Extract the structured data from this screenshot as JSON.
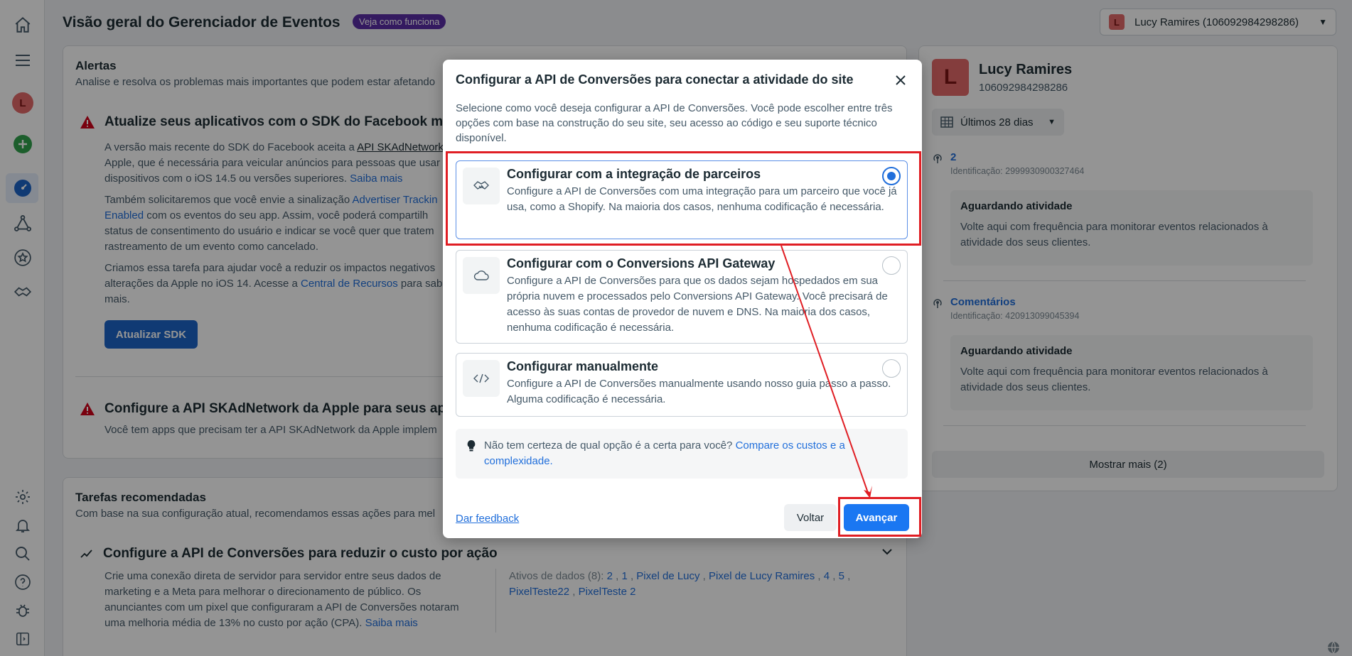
{
  "nav": {
    "avatar_letter": "L"
  },
  "header": {
    "title": "Visão geral do Gerenciador de Eventos",
    "how_badge": "Veja como funciona",
    "account_letter": "L",
    "account_label": "Lucy Ramires (106092984298286)"
  },
  "alerts": {
    "title": "Alertas",
    "subtitle": "Analise e resolva os problemas mais importantes que podem estar afetando",
    "item1": {
      "title": "Atualize seus aplicativos com o SDK do Facebook mais recen",
      "p1_a": "A versão mais recente do SDK do Facebook aceita a ",
      "p1_link": "API SKAdNetwork",
      "p1_b": "Apple, que é necessária para veicular anúncios para pessoas que usar",
      "p1_c": "dispositivos com o iOS 14.5 ou versões superiores. ",
      "p1_more": "Saiba mais",
      "p2_a": "Também solicitaremos que você envie a sinalização ",
      "p2_link1": "Advertiser Trackin",
      "p2_link2": "Enabled",
      "p2_b": " com os eventos do seu app. Assim, você poderá compartilh",
      "p2_c": "status de consentimento do usuário e indicar se você quer que tratem",
      "p2_d": "rastreamento de um evento como cancelado.",
      "p3_a": "Criamos essa tarefa para ajudar você a reduzir os impactos negativos",
      "p3_b": "alterações da Apple no iOS 14. Acesse a ",
      "p3_link": "Central de Recursos",
      "p3_c": " para sab",
      "p3_d": "mais.",
      "button": "Atualizar SDK"
    },
    "item2": {
      "title": "Configure a API SKAdNetwork da Apple para seus apps",
      "text": "Você tem apps que precisam ter a API SKAdNetwork da Apple implem"
    }
  },
  "tasks": {
    "title": "Tarefas recomendadas",
    "subtitle": "Com base na sua configuração atual, recomendamos essas ações para mel",
    "item_title": "Configure a API de Conversões para reduzir o custo por ação",
    "p_a": "Crie uma conexão direta de servidor para servidor entre seus dados de",
    "p_b": "marketing e a Meta para melhorar o direcionamento de público. Os",
    "p_c": "anunciantes com um pixel que configuraram a API de Conversões notaram",
    "p_d": "uma melhoria média de 13% no custo por ação (CPA). ",
    "p_more": "Saiba mais",
    "assets_label": "Ativos de dados (8): ",
    "assets": [
      "2",
      "1",
      "Pixel de Lucy",
      "Pixel de Lucy Ramires",
      "4",
      "5",
      "PixelTeste22",
      "PixelTeste 2"
    ]
  },
  "right_panel": {
    "avatar_letter": "L",
    "name": "Lucy Ramires",
    "id": "106092984298286",
    "date_range": "Últimos 28 dias",
    "sources": [
      {
        "title": "2",
        "id": "Identificação: 2999930900327464",
        "await_title": "Aguardando atividade",
        "await_text": "Volte aqui com frequência para monitorar eventos relacionados à atividade dos seus clientes."
      },
      {
        "title": "Comentários",
        "id": "Identificação: 420913099045394",
        "await_title": "Aguardando atividade",
        "await_text": "Volte aqui com frequência para monitorar eventos relacionados à atividade dos seus clientes."
      }
    ],
    "show_more": "Mostrar mais (2)"
  },
  "modal": {
    "title": "Configurar a API de Conversões para conectar a atividade do site",
    "description": "Selecione como você deseja configurar a API de Conversões. Você pode escolher entre três opções com base na construção do seu site, seu acesso ao código e seu suporte técnico disponível.",
    "options": [
      {
        "title": "Configurar com a integração de parceiros",
        "desc": "Configure a API de Conversões com uma integração para um parceiro que você já usa, como a Shopify. Na maioria dos casos, nenhuma codificação é necessária.",
        "icon": "handshake-icon",
        "selected": true
      },
      {
        "title": "Configurar com o Conversions API Gateway",
        "desc": "Configure a API de Conversões para que os dados sejam hospedados em sua própria nuvem e processados pelo Conversions API Gateway. Você precisará de acesso às suas contas de provedor de nuvem e DNS. Na maioria dos casos, nenhuma codificação é necessária.",
        "icon": "cloud-icon",
        "selected": false
      },
      {
        "title": "Configurar manualmente",
        "desc": "Configure a API de Conversões manualmente usando nosso guia passo a passo. Alguma codificação é necessária.",
        "icon": "code-icon",
        "selected": false
      }
    ],
    "hint_text": "Não tem certeza de qual opção é a certa para você? ",
    "hint_link": "Compare os custos e a complexidade.",
    "feedback": "Dar feedback",
    "back": "Voltar",
    "next": "Avançar"
  },
  "colors": {
    "accent": "#1a77f2",
    "highlight": "#e01e24",
    "badge": "#5b2ea6"
  }
}
